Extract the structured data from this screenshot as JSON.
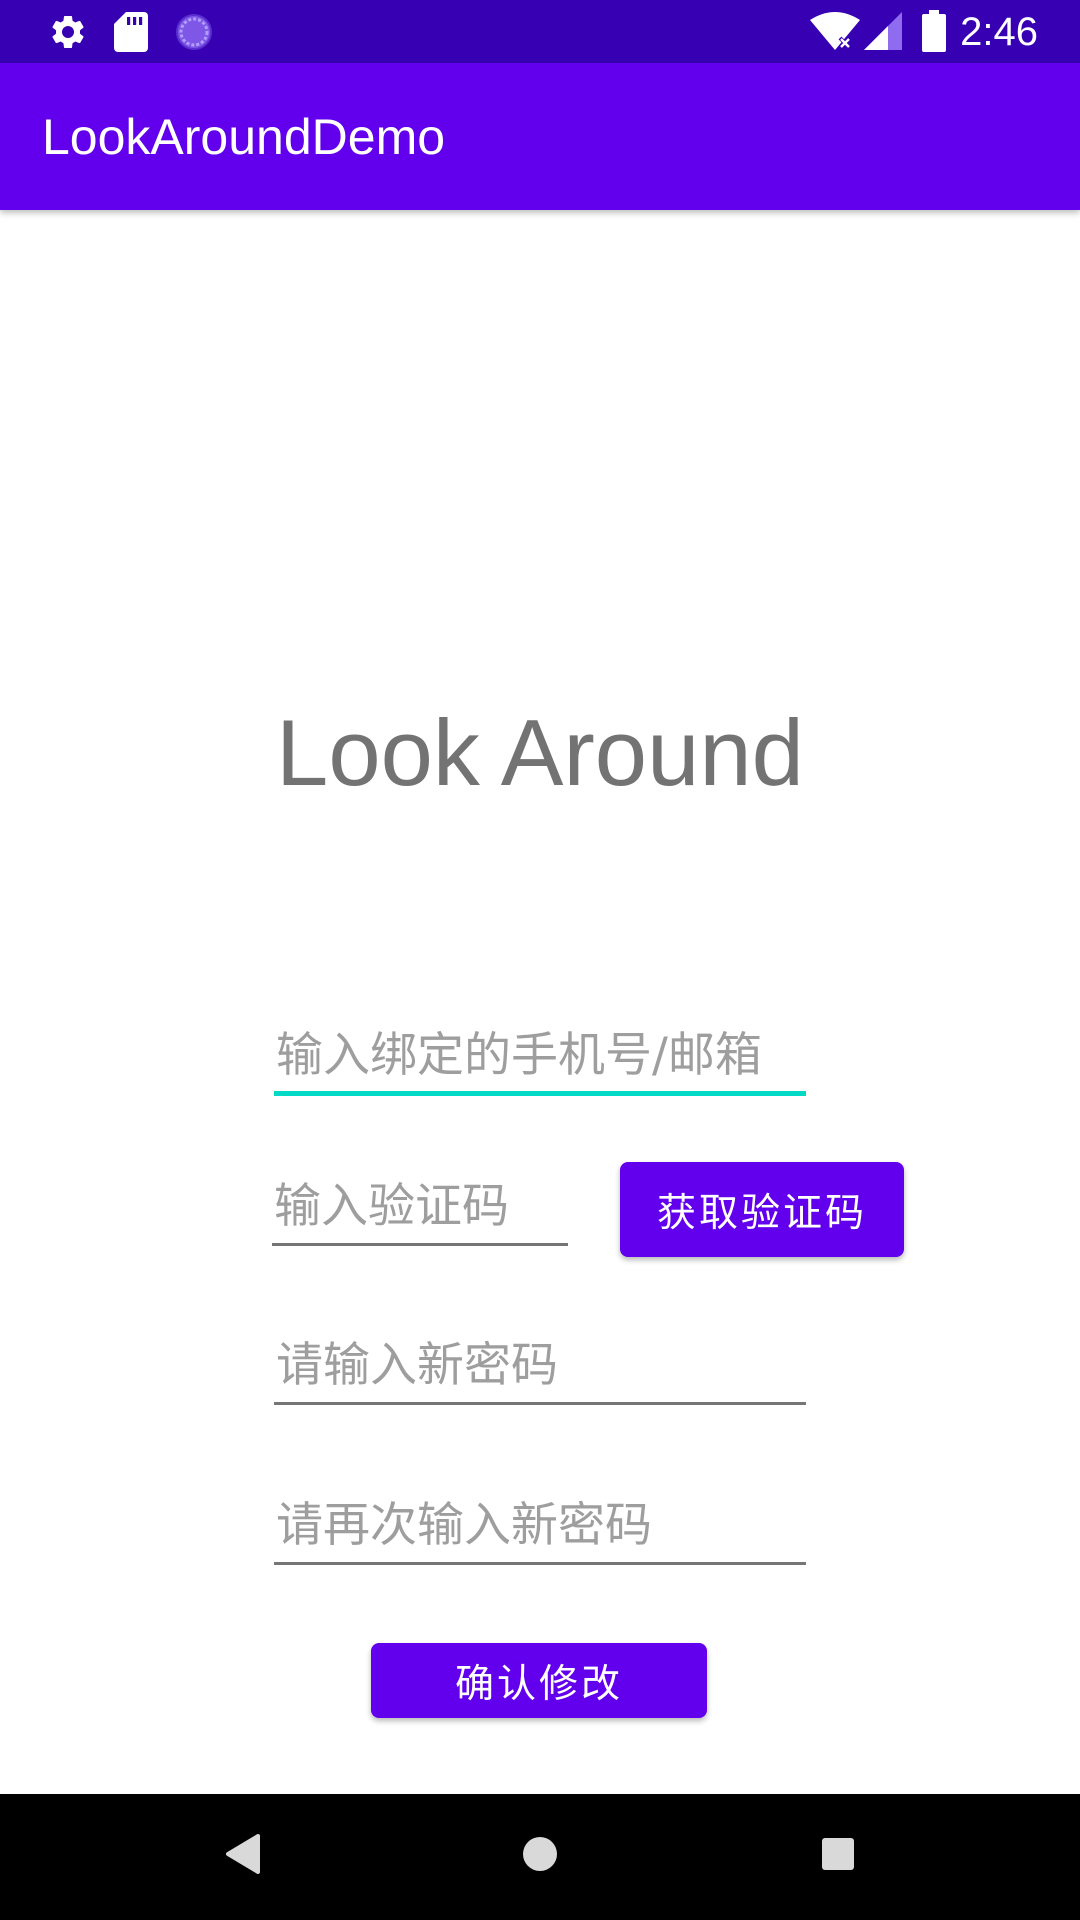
{
  "status_bar": {
    "time": "2:46",
    "left_icons": [
      "gear-icon",
      "sd-card-icon",
      "loading-icon"
    ],
    "right_icons": [
      "wifi-icon",
      "cell-signal-icon",
      "battery-icon"
    ],
    "background": "#3700B3"
  },
  "app_bar": {
    "title": "LookAroundDemo",
    "background": "#6200EE"
  },
  "brand": {
    "title": "Look Around"
  },
  "form": {
    "account": {
      "placeholder": "输入绑定的手机号/邮箱",
      "value": ""
    },
    "code": {
      "placeholder": "输入验证码",
      "value": ""
    },
    "get_code_label": "获取验证码",
    "new_password": {
      "placeholder": "请输入新密码",
      "value": ""
    },
    "confirm_password": {
      "placeholder": "请再次输入新密码",
      "value": ""
    },
    "submit_label": "确认修改"
  },
  "nav_bar": {
    "buttons": [
      "back-icon",
      "home-icon",
      "recents-icon"
    ]
  },
  "colors": {
    "accent": "#03DAC5",
    "primary": "#6200EE",
    "primary_dark": "#3700B3",
    "heading_text": "#737373",
    "placeholder_text": "#9e9e9e"
  }
}
